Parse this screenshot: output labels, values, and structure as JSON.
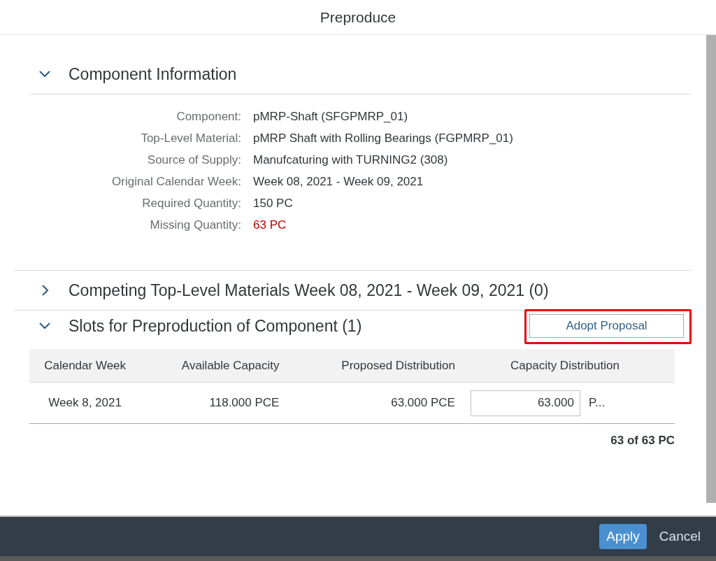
{
  "dialog": {
    "title": "Preproduce"
  },
  "sections": [
    {
      "kind": "form",
      "title": "Component Information",
      "expanded": true,
      "fields": [
        {
          "label": "Component:",
          "value": "pMRP-Shaft (SFGPMRP_01)",
          "error": false
        },
        {
          "label": "Top-Level Material:",
          "value": "pMRP Shaft with Rolling Bearings (FGPMRP_01)",
          "error": false
        },
        {
          "label": "Source of Supply:",
          "value": "Manufcaturing with TURNING2 (308)",
          "error": false
        },
        {
          "label": "Original Calendar Week:",
          "value": "Week 08, 2021 - Week 09, 2021",
          "error": false
        },
        {
          "label": "Required Quantity:",
          "value": "150 PC",
          "error": false
        },
        {
          "label": "Missing Quantity:",
          "value": "63 PC",
          "error": true
        }
      ]
    },
    {
      "kind": "collapsed",
      "title": "Competing Top-Level Materials Week 08, 2021 - Week 09, 2021 (0)",
      "expanded": false
    },
    {
      "kind": "table",
      "title": "Slots for Preproduction of Component (1)",
      "expanded": true,
      "action": {
        "label": "Adopt Proposal",
        "highlighted": true
      },
      "columns": [
        "Calendar Week",
        "Available Capacity",
        "Proposed Distribution",
        "Capacity Distribution"
      ],
      "rows": [
        {
          "calendar_week": "Week 8, 2021",
          "available_capacity": "118.000 PCE",
          "proposed_distribution": "63.000 PCE",
          "capacity_distribution": "63.000",
          "unit": "P..."
        }
      ],
      "total": "63 of 63 PC"
    }
  ],
  "footer": {
    "buttons": [
      {
        "label": "Apply",
        "kind": "emphasized"
      },
      {
        "label": "Cancel",
        "kind": "transparent"
      }
    ]
  }
}
